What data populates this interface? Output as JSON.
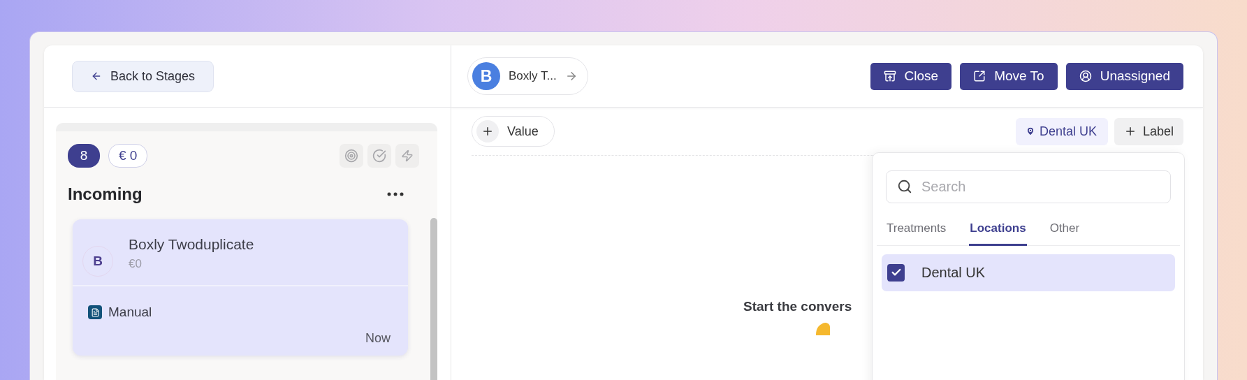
{
  "back_button": {
    "label": "Back to Stages"
  },
  "stage": {
    "count": "8",
    "amount": "€ 0",
    "title": "Incoming"
  },
  "deal_card": {
    "avatar": "B",
    "name": "Boxly Twoduplicate",
    "amount": "€0",
    "source": "Manual",
    "time": "Now",
    "selected": true
  },
  "contact_chip": {
    "avatar": "B",
    "name": "Boxly T..."
  },
  "actions": [
    {
      "kind": "close",
      "label": "Close"
    },
    {
      "kind": "move",
      "label": "Move To"
    },
    {
      "kind": "assign",
      "label": "Unassigned"
    }
  ],
  "value_button": {
    "label": "Value"
  },
  "location_tag": {
    "label": "Dental UK"
  },
  "label_button": {
    "label": "Label"
  },
  "empty_state": {
    "title": "Start the convers"
  },
  "dropdown": {
    "search": {
      "placeholder": "Search"
    },
    "tabs": [
      {
        "label": "Treatments",
        "selected": false
      },
      {
        "label": "Locations",
        "selected": true
      },
      {
        "label": "Other",
        "selected": false
      }
    ],
    "items": [
      {
        "label": "Dental UK",
        "checked": true
      }
    ]
  }
}
